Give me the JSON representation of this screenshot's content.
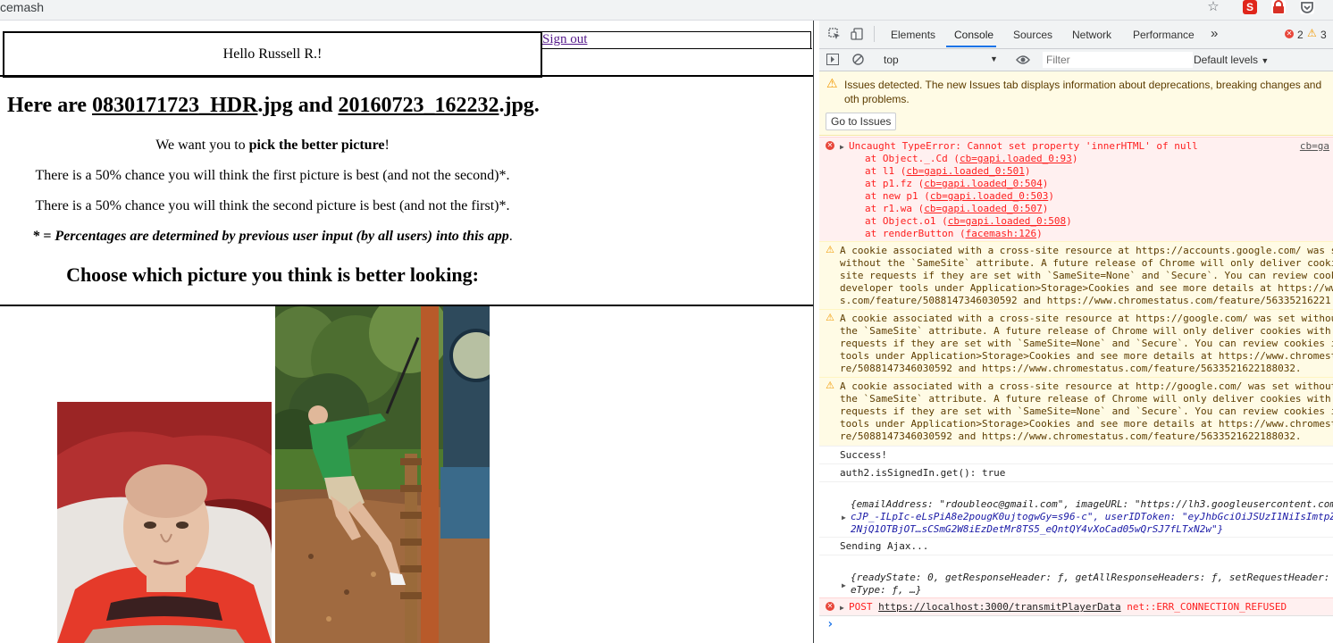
{
  "browser": {
    "tab_title": "cemash",
    "star_icon": "star-icon",
    "extensions": [
      "s-extension-icon",
      "lock-extension-icon",
      "pocket-icon"
    ]
  },
  "page": {
    "greeting": "Hello Russell R.!",
    "signout_label": "Sign out",
    "headline_pre": "Here are ",
    "file1": "0830171723_HDR",
    "file1_ext": ".jpg",
    "headline_and": " and ",
    "file2": "20160723_162232",
    "file2_ext": ".jpg",
    "headline_end": ".",
    "want_pre": "We want you to ",
    "want_bold": "pick the better picture",
    "want_end": "!",
    "chance1": "There is a 50% chance you will think the first picture is best (and not the second)*.",
    "chance2": "There is a 50% chance you will think the second picture is best (and not the first)*.",
    "footnote": "* = Percentages are determined by previous user input (by all users) into this app",
    "footnote_end": ".",
    "choose": "Choose which picture you think is better looking:"
  },
  "devtools": {
    "tabs": [
      "Elements",
      "Console",
      "Sources",
      "Network",
      "Performance"
    ],
    "active_tab": "Console",
    "more_tabs": "»",
    "error_count": "2",
    "warning_count": "3",
    "context": "top",
    "filter_placeholder": "Filter",
    "levels": "Default levels",
    "issues_text": "Issues detected. The new Issues tab displays information about deprecations, breaking changes and oth problems.",
    "goto_issues": "Go to Issues",
    "error1": {
      "title": "Uncaught TypeError: Cannot set property 'innerHTML' of null",
      "source": "cb=ga",
      "stack": [
        {
          "pre": "at Object._.Cd (",
          "link": "cb=gapi.loaded_0:93",
          "post": ")"
        },
        {
          "pre": "at l1 (",
          "link": "cb=gapi.loaded_0:501",
          "post": ")"
        },
        {
          "pre": "at p1.fz (",
          "link": "cb=gapi.loaded_0:504",
          "post": ")"
        },
        {
          "pre": "at new p1 (",
          "link": "cb=gapi.loaded_0:503",
          "post": ")"
        },
        {
          "pre": "at r1.wa (",
          "link": "cb=gapi.loaded_0:507",
          "post": ")"
        },
        {
          "pre": "at Object.o1 (",
          "link": "cb=gapi.loaded_0:508",
          "post": ")"
        },
        {
          "pre": "at renderButton (",
          "link": "facemash:126",
          "post": ")"
        }
      ]
    },
    "warn1": [
      "A cookie associated with a cross-site resource at https://accounts.google.com/ was s",
      "without the `SameSite` attribute. A future release of Chrome will only deliver cooki",
      "site requests if they are set with `SameSite=None` and `Secure`. You can review cook",
      "developer tools under Application>Storage>Cookies and see more details at https://ww",
      "s.com/feature/5088147346030592 and https://www.chromestatus.com/feature/56335216221"
    ],
    "warn2": [
      "A cookie associated with a cross-site resource at https://google.com/ was set withou",
      "the `SameSite` attribute. A future release of Chrome will only deliver cookies with",
      "requests if they are set with `SameSite=None` and `Secure`. You can review cookies i",
      "tools under Application>Storage>Cookies and see more details at https://www.chromest",
      "re/5088147346030592 and https://www.chromestatus.com/feature/5633521622188032."
    ],
    "warn3": [
      "A cookie associated with a cross-site resource at http://google.com/ was set without",
      "the `SameSite` attribute. A future release of Chrome will only deliver cookies with",
      "requests if they are set with `SameSite=None` and `Secure`. You can review cookies i",
      "tools under Application>Storage>Cookies and see more details at https://www.chromest",
      "re/5088147346030592 and https://www.chromestatus.com/feature/5633521622188032."
    ],
    "log_success": "Success!",
    "log_signed_in": "auth2.isSignedIn.get(): true",
    "obj1_line1": "{emailAddress: \"rdoubleoc@gmail.com\", imageURL: \"https://lh3.googleusercontent.com",
    "obj1_line2": "cJP_-ILpIc-eLsPiA8e2pougK0ujtogwGy=s96-c\", userIDToken: \"eyJhbGciOiJSUzI1NiIsImtpZ",
    "obj1_line3": "2NjQ1OTBjOT…sCSmG2W8iEzDetMr8TS5_eQntQY4vXoCad05wQrSJ7fLTxN2w\"}",
    "log_sending": "Sending Ajax...",
    "obj2_line1": "{readyState: 0, getResponseHeader: ƒ, getAllResponseHeaders: ƒ, setRequestHeader:",
    "obj2_line2": "eType: ƒ, …}",
    "error2_method": "POST",
    "error2_url": "https://localhost:3000/transmitPlayerData",
    "error2_msg": "net::ERR_CONNECTION_REFUSED",
    "prompt": "›"
  },
  "colors": {
    "link_visited": "#551a8b",
    "console_error": "#fe2020",
    "devtools_accent": "#1a73e8",
    "warning_bg": "#fffbe5",
    "error_bg": "#fff0f0"
  }
}
